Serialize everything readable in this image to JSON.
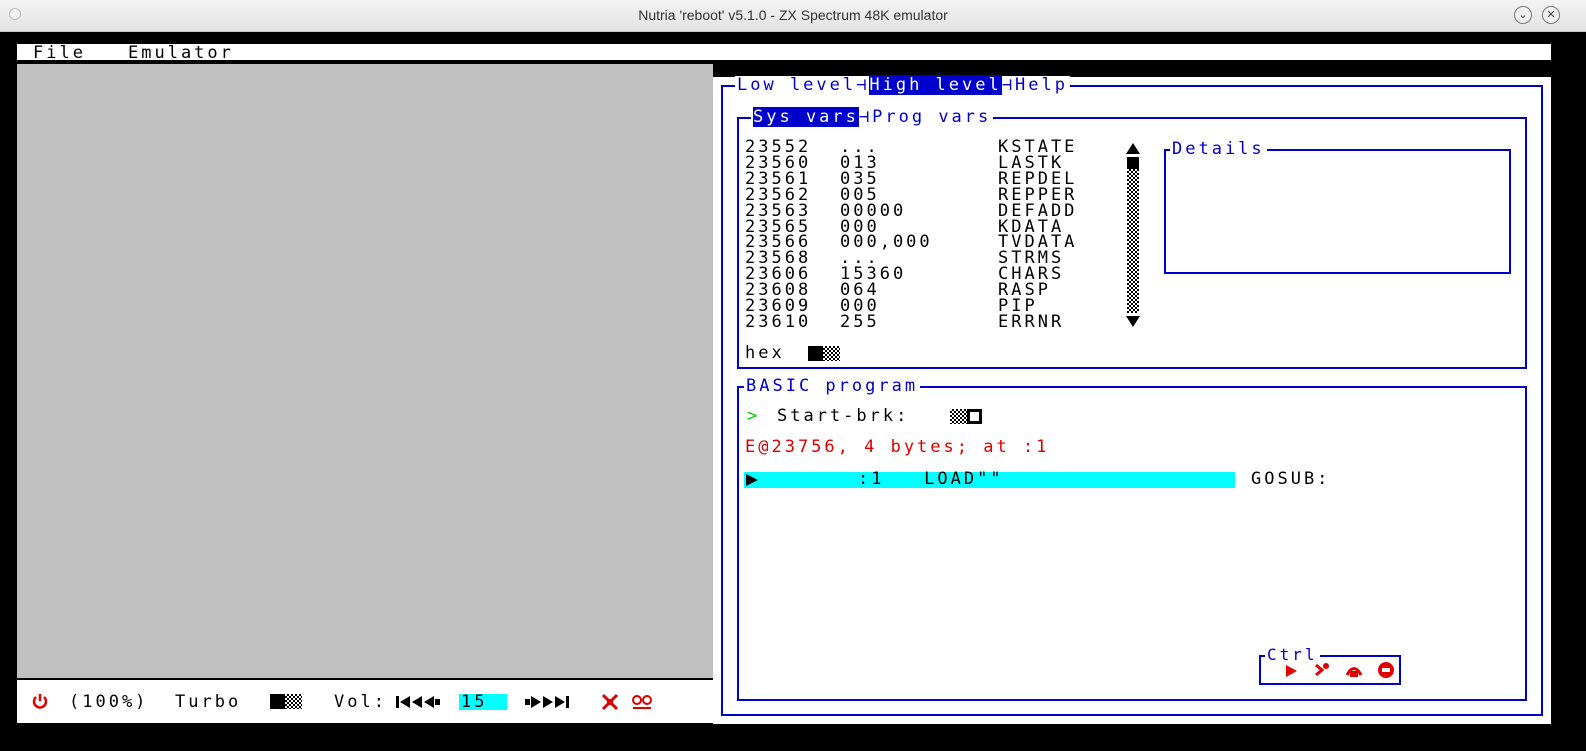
{
  "window": {
    "title": "Nutria 'reboot' v5.1.0 - ZX Spectrum 48K emulator"
  },
  "menu": {
    "file": "File",
    "emulator": "Emulator"
  },
  "tabs": {
    "low": "Low level",
    "high": "High level",
    "help": "Help"
  },
  "subtabs": {
    "sys": "Sys vars",
    "prog": "Prog vars"
  },
  "sysvars": [
    {
      "addr": "23552",
      "val": "...",
      "name": "KSTATE"
    },
    {
      "addr": "23560",
      "val": "013",
      "name": "LASTK"
    },
    {
      "addr": "23561",
      "val": "035",
      "name": "REPDEL"
    },
    {
      "addr": "23562",
      "val": "005",
      "name": "REPPER"
    },
    {
      "addr": "23563",
      "val": "00000",
      "name": "DEFADD"
    },
    {
      "addr": "23565",
      "val": "000",
      "name": "KDATA"
    },
    {
      "addr": "23566",
      "val": "000,000",
      "name": "TVDATA"
    },
    {
      "addr": "23568",
      "val": "...",
      "name": "STRMS"
    },
    {
      "addr": "23606",
      "val": "15360",
      "name": "CHARS"
    },
    {
      "addr": "23608",
      "val": "064",
      "name": "RASP"
    },
    {
      "addr": "23609",
      "val": "000",
      "name": "PIP"
    },
    {
      "addr": "23610",
      "val": "255",
      "name": "ERRNR"
    }
  ],
  "details": {
    "title": "Details"
  },
  "hex_label": "hex",
  "basic": {
    "title": "BASIC program",
    "prompt": ">",
    "start_brk": "Start-brk:",
    "error": "E@23756, 4 bytes; at :1",
    "line": ":1   LOAD\"\"",
    "gosub": "GOSUB:"
  },
  "ctrl": {
    "title": "Ctrl"
  },
  "statusbar": {
    "zoom": "(100%)",
    "turbo": "Turbo",
    "vol_label": "Vol:",
    "vol_value": "15"
  },
  "colors": {
    "blue": "#0000cc",
    "red": "#e00000",
    "cyan": "#00ffff",
    "green": "#00cc00",
    "screen_gray": "#c0c0c0"
  }
}
